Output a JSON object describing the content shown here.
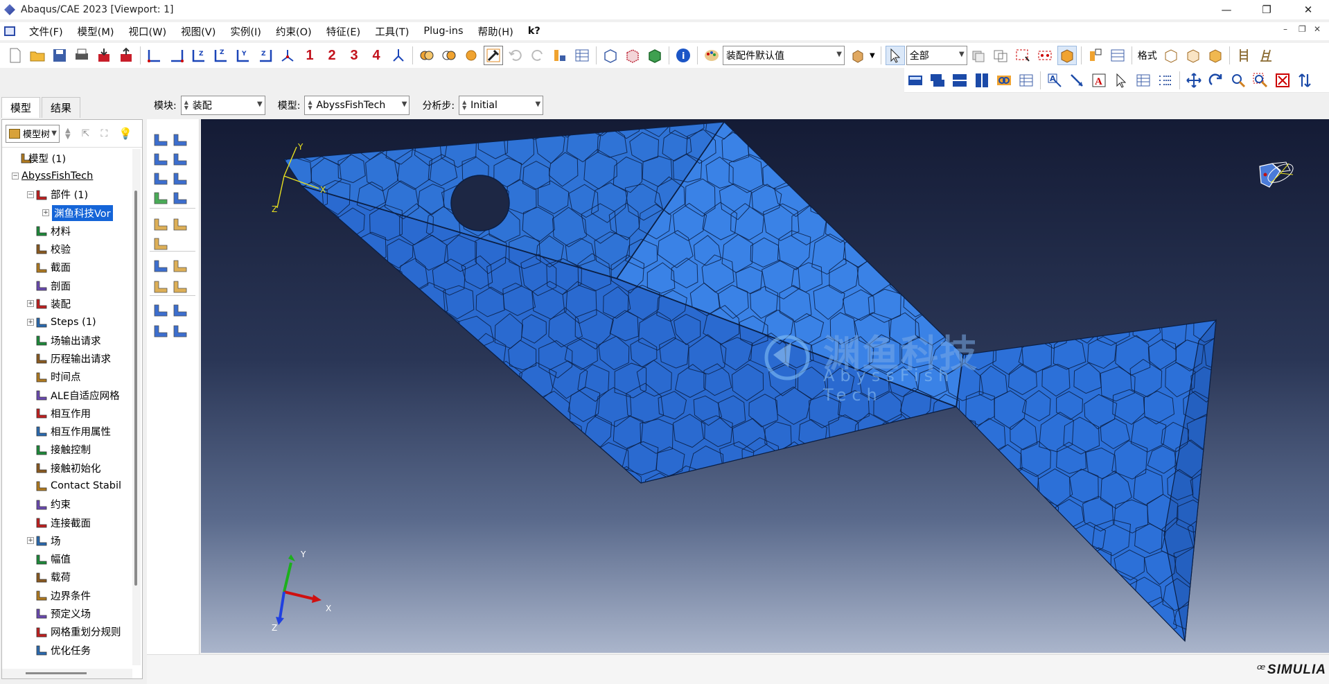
{
  "window": {
    "title": "Abaqus/CAE 2023 [Viewport: 1]",
    "controls": [
      "—",
      "❐",
      "✕"
    ]
  },
  "menubar": {
    "items": [
      "文件(F)",
      "模型(M)",
      "视口(W)",
      "视图(V)",
      "实例(I)",
      "约束(O)",
      "特征(E)",
      "工具(T)",
      "Plug-ins",
      "帮助(H)",
      "k?"
    ]
  },
  "toolbar": {
    "assembly_default": "装配件默认值",
    "select_scope": "全部",
    "format_label": "格式",
    "numbers": [
      "1",
      "2",
      "3",
      "4"
    ]
  },
  "context": {
    "module_label": "模块:",
    "module_value": "装配",
    "model_label": "模型:",
    "model_value": "AbyssFishTech",
    "step_label": "分析步:",
    "step_value": "Initial"
  },
  "left_tabs": [
    "模型",
    "结果"
  ],
  "tree_selector": "模型树",
  "tree": [
    {
      "label": "模型 (1)",
      "level": 0,
      "expander": "",
      "icon": "models-icon"
    },
    {
      "label": "AbyssFishTech",
      "level": 0,
      "expander": "−",
      "icon": "",
      "style": "underline"
    },
    {
      "label": "部件 (1)",
      "level": 1,
      "expander": "−",
      "icon": "parts-icon"
    },
    {
      "label": "渊鱼科技Vor",
      "level": 2,
      "expander": "+",
      "icon": "",
      "style": "selected"
    },
    {
      "label": "材料",
      "level": 1,
      "expander": "",
      "icon": "materials-icon"
    },
    {
      "label": "校验",
      "level": 1,
      "expander": "",
      "icon": "calibration-icon"
    },
    {
      "label": "截面",
      "level": 1,
      "expander": "",
      "icon": "sections-icon"
    },
    {
      "label": "剖面",
      "level": 1,
      "expander": "",
      "icon": "profiles-icon"
    },
    {
      "label": "装配",
      "level": 1,
      "expander": "+",
      "icon": "assembly-icon"
    },
    {
      "label": "Steps (1)",
      "level": 1,
      "expander": "+",
      "icon": "steps-icon"
    },
    {
      "label": "场输出请求",
      "level": 1,
      "expander": "",
      "icon": "field-output-icon"
    },
    {
      "label": "历程输出请求",
      "level": 1,
      "expander": "",
      "icon": "history-output-icon"
    },
    {
      "label": "时间点",
      "level": 1,
      "expander": "",
      "icon": "time-points-icon"
    },
    {
      "label": "ALE自适应网格",
      "level": 1,
      "expander": "",
      "icon": "ale-icon"
    },
    {
      "label": "相互作用",
      "level": 1,
      "expander": "",
      "icon": "interactions-icon"
    },
    {
      "label": "相互作用属性",
      "level": 1,
      "expander": "",
      "icon": "interaction-props-icon"
    },
    {
      "label": "接触控制",
      "level": 1,
      "expander": "",
      "icon": "contact-controls-icon"
    },
    {
      "label": "接触初始化",
      "level": 1,
      "expander": "",
      "icon": "contact-init-icon"
    },
    {
      "label": "Contact Stabil",
      "level": 1,
      "expander": "",
      "icon": "contact-stab-icon"
    },
    {
      "label": "约束",
      "level": 1,
      "expander": "",
      "icon": "constraints-icon"
    },
    {
      "label": "连接截面",
      "level": 1,
      "expander": "",
      "icon": "connector-sections-icon"
    },
    {
      "label": "场",
      "level": 1,
      "expander": "+",
      "icon": "fields-icon"
    },
    {
      "label": "幅值",
      "level": 1,
      "expander": "",
      "icon": "amplitudes-icon"
    },
    {
      "label": "载荷",
      "level": 1,
      "expander": "",
      "icon": "loads-icon"
    },
    {
      "label": "边界条件",
      "level": 1,
      "expander": "",
      "icon": "bcs-icon"
    },
    {
      "label": "预定义场",
      "level": 1,
      "expander": "",
      "icon": "predefined-fields-icon"
    },
    {
      "label": "网格重划分规则",
      "level": 1,
      "expander": "",
      "icon": "remesh-icon"
    },
    {
      "label": "优化任务",
      "level": 1,
      "expander": "",
      "icon": "optimization-icon"
    }
  ],
  "viewport": {
    "triad_axes": [
      "X",
      "Y",
      "Z"
    ],
    "watermark_cn": "渊鱼科技",
    "watermark_en": "AbyssFish Tech",
    "mesh_color": "#2f73d6",
    "edge_color": "#0b1f44"
  },
  "status": {
    "brand": "SIMULIA"
  }
}
